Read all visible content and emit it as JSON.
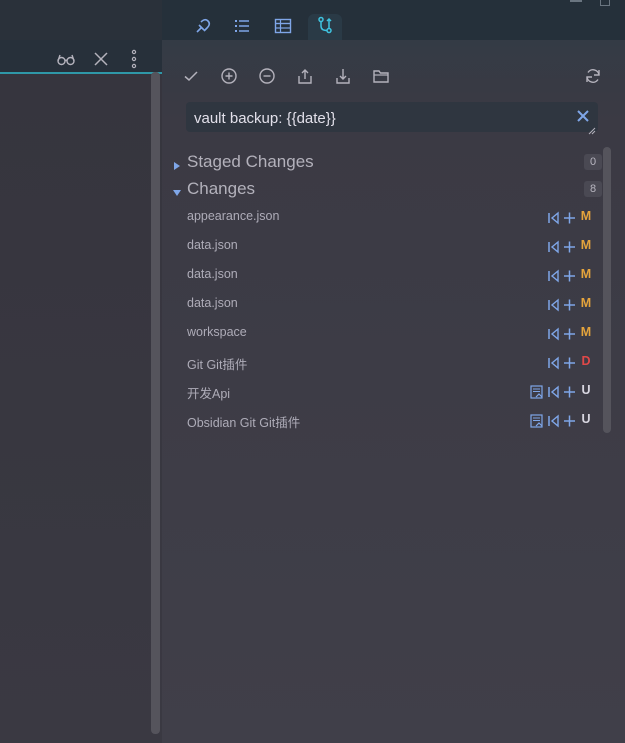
{
  "window": {
    "minimize_label": "",
    "maximize_label": ""
  },
  "tabs": [
    {
      "icon": "bookmark-link-icon",
      "active": false
    },
    {
      "icon": "list-icon",
      "active": false
    },
    {
      "icon": "table-icon",
      "active": false
    },
    {
      "icon": "git-branch-icon",
      "active": true
    }
  ],
  "left_header": {
    "icons": [
      "reading-glasses-icon",
      "close-icon",
      "more-options-icon"
    ]
  },
  "toolbar": {
    "buttons": [
      "commit-check-icon",
      "stage-all-plus-icon",
      "unstage-all-minus-icon",
      "push-upload-icon",
      "pull-download-icon",
      "open-folder-icon",
      "refresh-icon"
    ]
  },
  "commit": {
    "message": "vault backup: {{date}}"
  },
  "staged": {
    "label": "Staged Changes",
    "count": "0",
    "expanded": false
  },
  "changes": {
    "label": "Changes",
    "count": "8",
    "expanded": true,
    "files": [
      {
        "name": "appearance.json",
        "status": "M",
        "status_color": "#e5a43c",
        "open_file": false
      },
      {
        "name": "data.json",
        "status": "M",
        "status_color": "#e5a43c",
        "open_file": false
      },
      {
        "name": "data.json",
        "status": "M",
        "status_color": "#e5a43c",
        "open_file": false
      },
      {
        "name": "data.json",
        "status": "M",
        "status_color": "#e5a43c",
        "open_file": false
      },
      {
        "name": "workspace",
        "status": "M",
        "status_color": "#e5a43c",
        "open_file": false
      },
      {
        "name": "Git Git插件",
        "status": "D",
        "status_color": "#e04848",
        "open_file": false
      },
      {
        "name": "开发Api",
        "status": "U",
        "status_color": "#d8d6e0",
        "open_file": true
      },
      {
        "name": "Obsidian Git Git插件",
        "status": "U",
        "status_color": "#d8d6e0",
        "open_file": true
      }
    ]
  },
  "colors": {
    "accent": "#2f98a8",
    "icon_blue": "#7fa6e8",
    "modified": "#e5a43c",
    "deleted": "#e04848"
  }
}
